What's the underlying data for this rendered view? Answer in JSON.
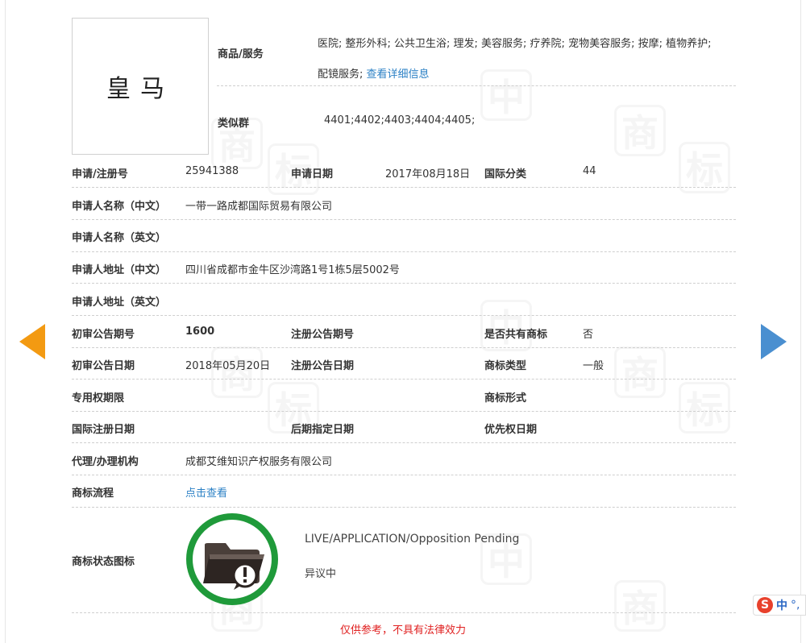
{
  "trademark": {
    "logo_text": "皇马",
    "goods_label": "商品/服务",
    "goods_line1": "医院; 整形外科; 公共卫生浴; 理发; 美容服务; 疗养院; 宠物美容服务; 按摩; 植物养护;",
    "goods_line2": "配镜服务; ",
    "goods_more_link": "查看详细信息",
    "similar_label": "类似群",
    "similar_value": "4401;4402;4403;4404;4405;"
  },
  "fields": {
    "reg_no_label": "申请/注册号",
    "reg_no_value": "25941388",
    "apply_date_label": "申请日期",
    "apply_date_value": "2017年08月18日",
    "intl_class_label": "国际分类",
    "intl_class_value": "44",
    "applicant_cn_label": "申请人名称（中文）",
    "applicant_cn_value": "一带一路成都国际贸易有限公司",
    "applicant_en_label": "申请人名称（英文）",
    "address_cn_label": "申请人地址（中文）",
    "address_cn_value": "四川省成都市金牛区沙湾路1号1栋5层5002号",
    "address_en_label": "申请人地址（英文）",
    "prelim_pub_no_label": "初审公告期号",
    "prelim_pub_no_value": "1600",
    "reg_pub_no_label": "注册公告期号",
    "shared_label": "是否共有商标",
    "shared_value": "否",
    "prelim_pub_date_label": "初审公告日期",
    "prelim_pub_date_value": "2018年05月20日",
    "reg_pub_date_label": "注册公告日期",
    "tm_type_label": "商标类型",
    "tm_type_value": "一般",
    "exclusive_period_label": "专用权期限",
    "tm_form_label": "商标形式",
    "intl_reg_date_label": "国际注册日期",
    "later_designation_label": "后期指定日期",
    "priority_date_label": "优先权日期",
    "agent_label": "代理/办理机构",
    "agent_value": "成都艾维知识产权服务有限公司",
    "process_label": "商标流程",
    "process_link": "点击查看",
    "status_icon_label": "商标状态图标"
  },
  "status": {
    "en": "LIVE/APPLICATION/Opposition Pending",
    "cn": "异议中",
    "ring_color": "#1f9a3a"
  },
  "disclaimer": "仅供参考，不具有法律效力",
  "ime": {
    "logo": "S",
    "lang": "中",
    "punct": "°,"
  },
  "colors": {
    "link": "#2b80c5",
    "prev_arrow": "#f39a12",
    "next_arrow": "#4a8fd0",
    "disclaimer": "#e02020"
  }
}
